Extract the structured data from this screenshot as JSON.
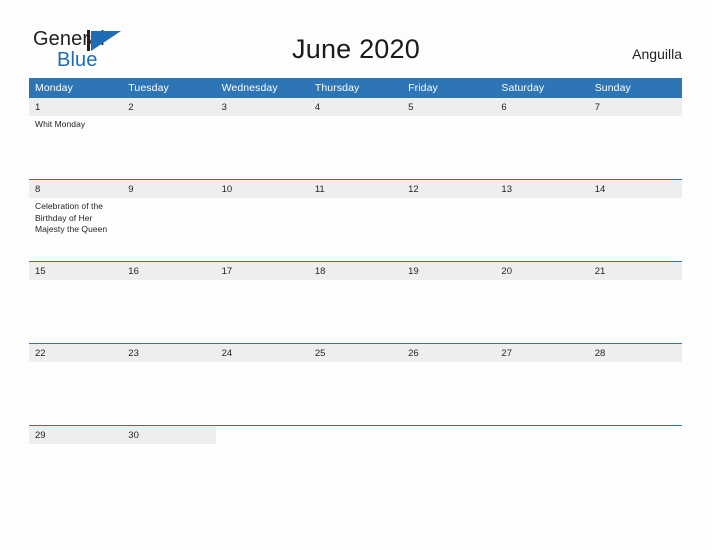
{
  "brand": {
    "word_one": "General",
    "word_two": "Blue",
    "logo_icon": "blue-triangle-logo",
    "accent_color": "#1f6cb4",
    "dark_color": "#231f20"
  },
  "header": {
    "title": "June 2020",
    "region": "Anguilla"
  },
  "theme": {
    "header_blue": "#2e75b6",
    "day_band_gray": "#eeeeee",
    "page_background": "#fdfdfd",
    "text_color": "#231f20"
  },
  "calendar": {
    "month": "June",
    "year": "2020",
    "weekday_headers": [
      "Monday",
      "Tuesday",
      "Wednesday",
      "Thursday",
      "Friday",
      "Saturday",
      "Sunday"
    ],
    "weeks": [
      [
        {
          "day": "1",
          "events": [
            "Whit Monday"
          ]
        },
        {
          "day": "2",
          "events": []
        },
        {
          "day": "3",
          "events": []
        },
        {
          "day": "4",
          "events": []
        },
        {
          "day": "5",
          "events": []
        },
        {
          "day": "6",
          "events": []
        },
        {
          "day": "7",
          "events": []
        }
      ],
      [
        {
          "day": "8",
          "events": [
            "Celebration of the Birthday of Her Majesty the Queen"
          ]
        },
        {
          "day": "9",
          "events": []
        },
        {
          "day": "10",
          "events": []
        },
        {
          "day": "11",
          "events": []
        },
        {
          "day": "12",
          "events": []
        },
        {
          "day": "13",
          "events": []
        },
        {
          "day": "14",
          "events": []
        }
      ],
      [
        {
          "day": "15",
          "events": []
        },
        {
          "day": "16",
          "events": []
        },
        {
          "day": "17",
          "events": []
        },
        {
          "day": "18",
          "events": []
        },
        {
          "day": "19",
          "events": []
        },
        {
          "day": "20",
          "events": []
        },
        {
          "day": "21",
          "events": []
        }
      ],
      [
        {
          "day": "22",
          "events": []
        },
        {
          "day": "23",
          "events": []
        },
        {
          "day": "24",
          "events": []
        },
        {
          "day": "25",
          "events": []
        },
        {
          "day": "26",
          "events": []
        },
        {
          "day": "27",
          "events": []
        },
        {
          "day": "28",
          "events": []
        }
      ],
      [
        {
          "day": "29",
          "events": []
        },
        {
          "day": "30",
          "events": []
        },
        {
          "day": "",
          "events": []
        },
        {
          "day": "",
          "events": []
        },
        {
          "day": "",
          "events": []
        },
        {
          "day": "",
          "events": []
        },
        {
          "day": "",
          "events": []
        }
      ]
    ]
  }
}
